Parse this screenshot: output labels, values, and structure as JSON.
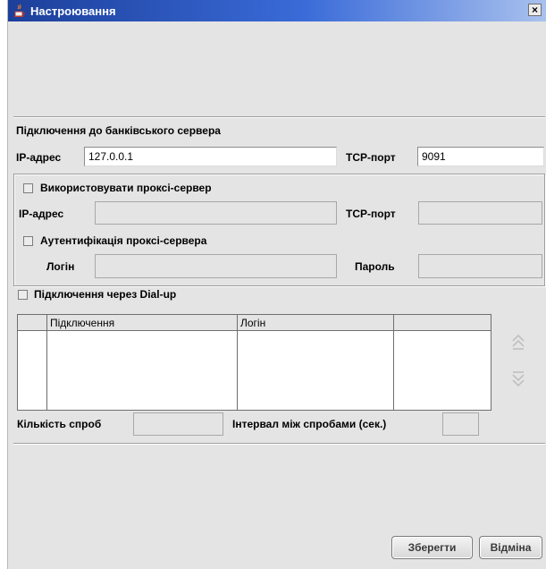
{
  "window": {
    "title": "Настроювання",
    "close_glyph": "×",
    "icon": "java-cup-icon"
  },
  "bank_server": {
    "section_title": "Підключення до банківського сервера",
    "ip_label": "IP-адрес",
    "ip_value": "127.0.0.1",
    "port_label": "TCP-порт",
    "port_value": "9091"
  },
  "proxy": {
    "use_proxy_label": "Використовувати проксі-сервер",
    "ip_label": "IP-адрес",
    "ip_value": "",
    "port_label": "TCP-порт",
    "port_value": "",
    "auth_label": "Аутентифікація проксі-сервера",
    "login_label": "Логін",
    "login_value": "",
    "password_label": "Пароль",
    "password_value": ""
  },
  "dialup": {
    "checkbox_label": "Підключення через Dial-up",
    "table": {
      "columns": [
        "",
        "Підключення",
        "Логін",
        ""
      ],
      "rows": []
    },
    "attempts_label": "Кількість спроб",
    "attempts_value": "",
    "interval_label": "Інтервал між спробами (сек.)",
    "interval_value": ""
  },
  "buttons": {
    "save": "Зберегти",
    "cancel": "Відміна"
  },
  "colors": {
    "titlebar_start": "#1c3f9a",
    "titlebar_end": "#a9c1ee",
    "window_bg": "#e4e4e4"
  }
}
